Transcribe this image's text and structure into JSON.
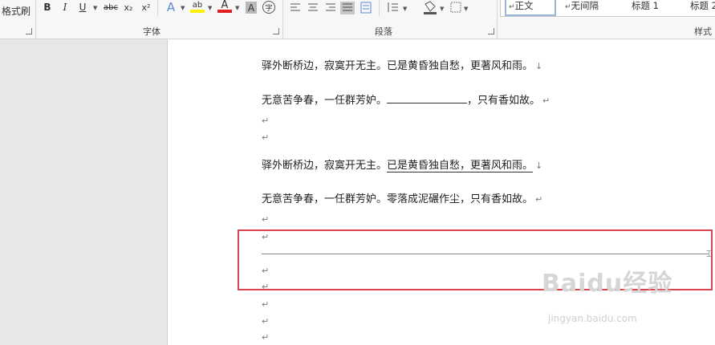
{
  "ribbon": {
    "clipboard": {
      "format_painter": "格式刷"
    },
    "font": {
      "group_label": "字体",
      "buttons": {
        "bold": "B",
        "italic": "I",
        "underline": "U",
        "strike": "abc",
        "subscript": "x₂",
        "superscript": "x²",
        "effects": "A",
        "highlight": "ab",
        "font_color": "A",
        "char_shade": "A",
        "phonetic": "字"
      }
    },
    "paragraph": {
      "group_label": "段落"
    },
    "styles": {
      "group_label": "样式",
      "items": [
        "正文",
        "无间隔",
        "标题 1",
        "标题 2"
      ]
    }
  },
  "document": {
    "paragraphs": [
      {
        "text": "驿外断桥边，寂寞开无主。已是黄昏独自愁，更著风和雨。",
        "mark": "↓"
      },
      {
        "text_before": "无意苦争春，一任群芳妒。",
        "text_after": "，只有香如故。",
        "mark": "↵"
      },
      {
        "mark": "↵"
      },
      {
        "mark": "↵"
      },
      {
        "text_plain": "驿外断桥边，寂寞开无主。",
        "text_underlined": "已是黄昏独自愁，更著风和雨。",
        "mark": "↓"
      },
      {
        "text": "无意苦争春，一任群芳妒。零落成泥碾作尘，只有香如故。",
        "mark": "↵"
      },
      {
        "mark": "↵"
      },
      {
        "mark": "↵"
      },
      {
        "mark": "↵"
      },
      {
        "mark": "↵"
      },
      {
        "mark": "↵"
      },
      {
        "mark": "↵"
      },
      {
        "mark": "↵"
      }
    ]
  },
  "watermark": {
    "logo": "Baidu经验",
    "url": "jingyan.baidu.com"
  },
  "colors": {
    "highlight_box": "#d9434b",
    "accent_underline": "#3a6fd8"
  }
}
